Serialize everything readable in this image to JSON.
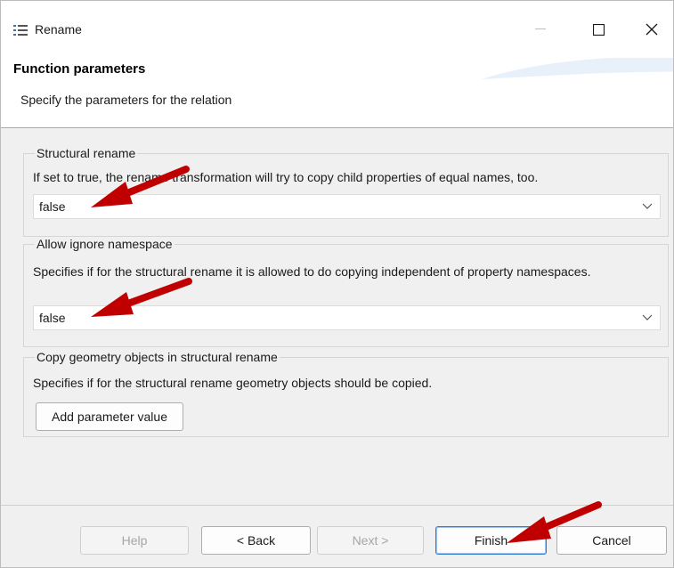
{
  "window": {
    "title": "Rename",
    "icons": {
      "app": "list-icon",
      "minimize": "minimize-icon",
      "maximize": "maximize-icon",
      "close": "close-icon"
    }
  },
  "banner": {
    "title": "Function parameters",
    "description": "Specify the parameters for the relation"
  },
  "groups": [
    {
      "title": "Structural rename",
      "description": "If set to true, the rename transformation will try to copy child properties of equal names, too.",
      "value": "false"
    },
    {
      "title": "Allow ignore namespace",
      "description": "Specifies if for the structural rename it is allowed to do copying independent of property namespaces.",
      "value": "false"
    },
    {
      "title": "Copy geometry objects in structural rename",
      "description": "Specifies if for the structural rename geometry objects should be copied.",
      "button_label": "Add parameter value"
    }
  ],
  "footer": {
    "help": "Help",
    "back": "< Back",
    "next": "Next >",
    "finish": "Finish",
    "cancel": "Cancel"
  },
  "colors": {
    "annotation_arrow": "#c00000",
    "default_button_border": "#2f7ad6"
  }
}
